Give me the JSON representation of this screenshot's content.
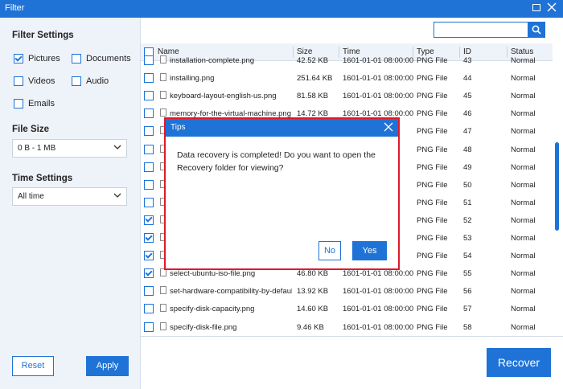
{
  "window": {
    "title": "Filter"
  },
  "sidebar": {
    "filter_settings_label": "Filter Settings",
    "types": [
      {
        "label": "Pictures",
        "checked": true
      },
      {
        "label": "Documents",
        "checked": false
      },
      {
        "label": "Videos",
        "checked": false
      },
      {
        "label": "Audio",
        "checked": false
      },
      {
        "label": "Emails",
        "checked": false
      }
    ],
    "file_size_label": "File Size",
    "file_size_value": "0 B - 1 MB",
    "time_settings_label": "Time Settings",
    "time_settings_value": "All time",
    "reset_label": "Reset",
    "apply_label": "Apply"
  },
  "table": {
    "headers": {
      "name": "Name",
      "size": "Size",
      "time": "Time",
      "type": "Type",
      "id": "ID",
      "status": "Status"
    },
    "rows": [
      {
        "checked": false,
        "name": "installation-complete.png",
        "size": "42.52 KB",
        "time": "1601-01-01 08:00:00",
        "type": "PNG File",
        "id": "43",
        "status": "Normal"
      },
      {
        "checked": false,
        "name": "installing.png",
        "size": "251.64 KB",
        "time": "1601-01-01 08:00:00",
        "type": "PNG File",
        "id": "44",
        "status": "Normal"
      },
      {
        "checked": false,
        "name": "keyboard-layout-english-us.png",
        "size": "81.58 KB",
        "time": "1601-01-01 08:00:00",
        "type": "PNG File",
        "id": "45",
        "status": "Normal"
      },
      {
        "checked": false,
        "name": "memory-for-the-virtual-machine.png",
        "size": "14.72 KB",
        "time": "1601-01-01 08:00:00",
        "type": "PNG File",
        "id": "46",
        "status": "Normal"
      },
      {
        "checked": false,
        "name": "",
        "size": "",
        "time": "",
        "type": "PNG File",
        "id": "47",
        "status": "Normal"
      },
      {
        "checked": false,
        "name": "",
        "size": "",
        "time": "",
        "type": "PNG File",
        "id": "48",
        "status": "Normal"
      },
      {
        "checked": false,
        "name": "",
        "size": "",
        "time": "",
        "type": "PNG File",
        "id": "49",
        "status": "Normal"
      },
      {
        "checked": false,
        "name": "",
        "size": "",
        "time": "",
        "type": "PNG File",
        "id": "50",
        "status": "Normal"
      },
      {
        "checked": false,
        "name": "",
        "size": "",
        "time": "",
        "type": "PNG File",
        "id": "51",
        "status": "Normal"
      },
      {
        "checked": true,
        "name": "",
        "size": "",
        "time": "",
        "type": "PNG File",
        "id": "52",
        "status": "Normal"
      },
      {
        "checked": true,
        "name": "",
        "size": "",
        "time": "",
        "type": "PNG File",
        "id": "53",
        "status": "Normal"
      },
      {
        "checked": true,
        "name": "",
        "size": "",
        "time": "",
        "type": "PNG File",
        "id": "54",
        "status": "Normal"
      },
      {
        "checked": true,
        "name": "select-ubuntu-iso-file.png",
        "size": "46.80 KB",
        "time": "1601-01-01 08:00:00",
        "type": "PNG File",
        "id": "55",
        "status": "Normal"
      },
      {
        "checked": false,
        "name": "set-hardware-compatibility-by-default.png",
        "size": "13.92 KB",
        "time": "1601-01-01 08:00:00",
        "type": "PNG File",
        "id": "56",
        "status": "Normal"
      },
      {
        "checked": false,
        "name": "specify-disk-capacity.png",
        "size": "14.60 KB",
        "time": "1601-01-01 08:00:00",
        "type": "PNG File",
        "id": "57",
        "status": "Normal"
      },
      {
        "checked": false,
        "name": "specify-disk-file.png",
        "size": "9.46 KB",
        "time": "1601-01-01 08:00:00",
        "type": "PNG File",
        "id": "58",
        "status": "Normal"
      }
    ]
  },
  "recover_label": "Recover",
  "dialog": {
    "title": "Tips",
    "message": "Data recovery is completed! Do you want to open the Recovery folder for viewing?",
    "no_label": "No",
    "yes_label": "Yes"
  }
}
